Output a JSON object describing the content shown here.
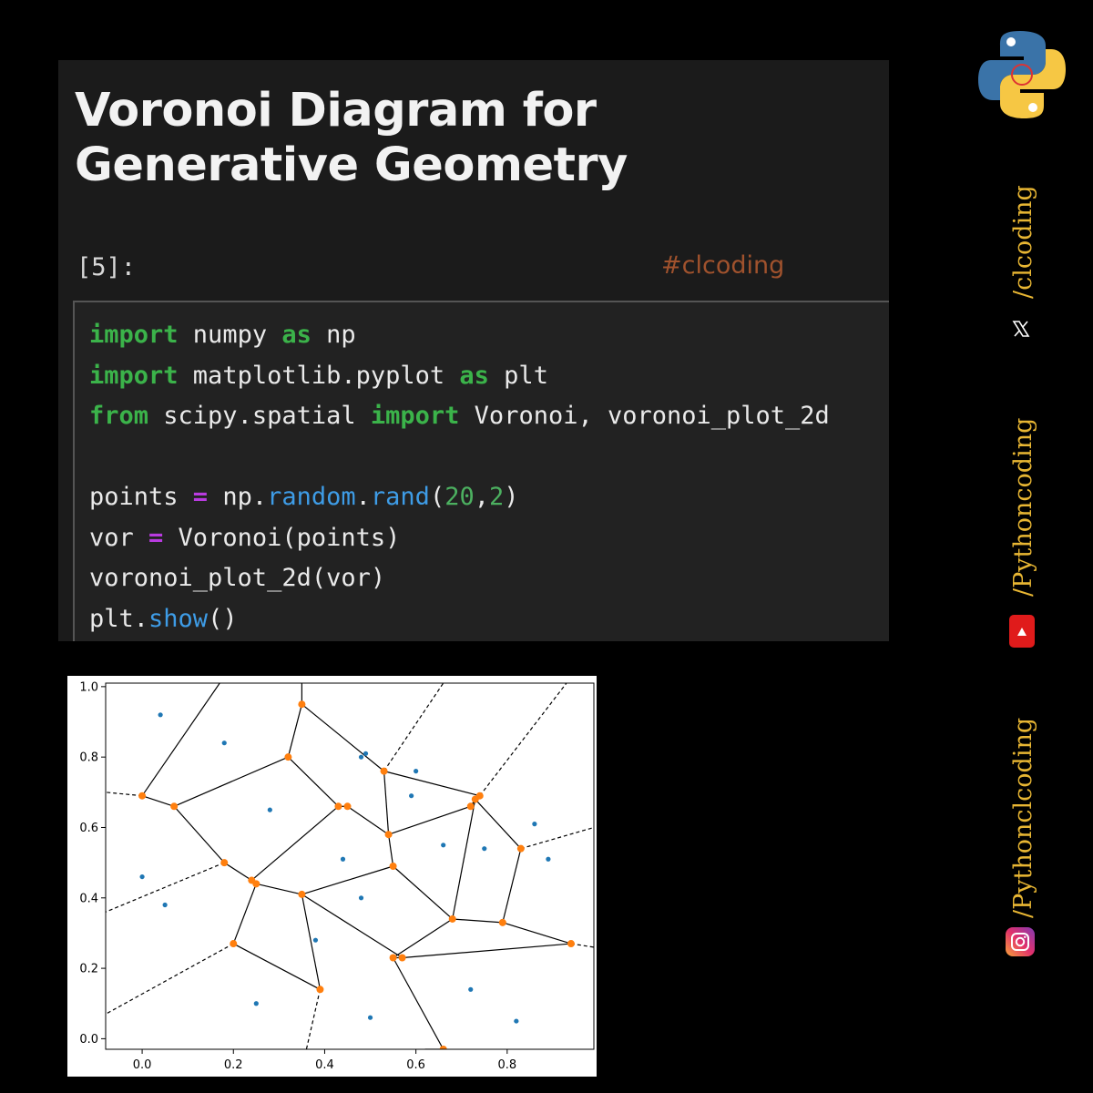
{
  "notebook": {
    "title": "Voronoi Diagram for Generative Geometry",
    "prompt": "[5]:",
    "hashtag": "#clcoding"
  },
  "code": {
    "lines": [
      [
        {
          "t": "import",
          "c": "kw"
        },
        {
          "t": " numpy ",
          "c": ""
        },
        {
          "t": "as",
          "c": "kw"
        },
        {
          "t": " np",
          "c": ""
        }
      ],
      [
        {
          "t": "import",
          "c": "kw"
        },
        {
          "t": " matplotlib.pyplot ",
          "c": ""
        },
        {
          "t": "as",
          "c": "kw"
        },
        {
          "t": " plt",
          "c": ""
        }
      ],
      [
        {
          "t": "from",
          "c": "kw"
        },
        {
          "t": " scipy.spatial ",
          "c": ""
        },
        {
          "t": "import",
          "c": "kw"
        },
        {
          "t": " Voronoi, voronoi_plot_2d",
          "c": ""
        }
      ],
      [],
      [
        {
          "t": "points ",
          "c": ""
        },
        {
          "t": "=",
          "c": "op"
        },
        {
          "t": " np.",
          "c": ""
        },
        {
          "t": "random",
          "c": "fn"
        },
        {
          "t": ".",
          "c": ""
        },
        {
          "t": "rand",
          "c": "fn"
        },
        {
          "t": "(",
          "c": ""
        },
        {
          "t": "20",
          "c": "num"
        },
        {
          "t": ",",
          "c": ""
        },
        {
          "t": "2",
          "c": "num"
        },
        {
          "t": ")",
          "c": ""
        }
      ],
      [
        {
          "t": "vor ",
          "c": ""
        },
        {
          "t": "=",
          "c": "op"
        },
        {
          "t": " Voronoi(points)",
          "c": ""
        }
      ],
      [
        {
          "t": "voronoi_plot_2d(vor)",
          "c": ""
        }
      ],
      [
        {
          "t": "plt.",
          "c": ""
        },
        {
          "t": "show",
          "c": "fn"
        },
        {
          "t": "()",
          "c": ""
        }
      ]
    ]
  },
  "chart_data": {
    "type": "scatter",
    "xlim": [
      -0.08,
      0.99
    ],
    "ylim": [
      -0.03,
      1.01
    ],
    "xticks": [
      "0.0",
      "0.2",
      "0.4",
      "0.6",
      "0.8"
    ],
    "xtick_values": [
      0.0,
      0.2,
      0.4,
      0.6,
      0.8
    ],
    "yticks": [
      "0.0",
      "0.2",
      "0.4",
      "0.6",
      "0.8",
      "1.0"
    ],
    "ytick_values": [
      0.0,
      0.2,
      0.4,
      0.6,
      0.8,
      1.0
    ],
    "grid": false,
    "colors": {
      "points": "#1f77b4",
      "vertices": "#ff7f0e",
      "edges": "#000000"
    },
    "points": [
      [
        0.04,
        0.92
      ],
      [
        0.18,
        0.84
      ],
      [
        0.48,
        0.8
      ],
      [
        0.49,
        0.81
      ],
      [
        0.6,
        0.76
      ],
      [
        0.28,
        0.65
      ],
      [
        0.59,
        0.69
      ],
      [
        0.86,
        0.61
      ],
      [
        0.0,
        0.46
      ],
      [
        0.44,
        0.51
      ],
      [
        0.66,
        0.55
      ],
      [
        0.75,
        0.54
      ],
      [
        0.89,
        0.51
      ],
      [
        0.05,
        0.38
      ],
      [
        0.48,
        0.4
      ],
      [
        0.38,
        0.28
      ],
      [
        0.25,
        0.1
      ],
      [
        0.5,
        0.06
      ],
      [
        0.72,
        0.14
      ],
      [
        0.82,
        0.05
      ]
    ],
    "vertices": [
      [
        0.0,
        0.69
      ],
      [
        0.07,
        0.66
      ],
      [
        0.32,
        0.8
      ],
      [
        0.35,
        0.95
      ],
      [
        0.53,
        0.76
      ],
      [
        0.43,
        0.66
      ],
      [
        0.45,
        0.66
      ],
      [
        0.54,
        0.58
      ],
      [
        0.18,
        0.5
      ],
      [
        0.24,
        0.45
      ],
      [
        0.25,
        0.44
      ],
      [
        0.35,
        0.41
      ],
      [
        0.55,
        0.49
      ],
      [
        0.2,
        0.27
      ],
      [
        0.39,
        0.14
      ],
      [
        0.55,
        0.23
      ],
      [
        0.57,
        0.23
      ],
      [
        0.68,
        0.34
      ],
      [
        0.79,
        0.33
      ],
      [
        0.72,
        0.66
      ],
      [
        0.74,
        0.69
      ],
      [
        0.73,
        0.68
      ],
      [
        0.83,
        0.54
      ],
      [
        0.94,
        0.27
      ],
      [
        0.66,
        -0.03
      ]
    ],
    "edges": [
      [
        0,
        1
      ],
      [
        1,
        8
      ],
      [
        8,
        9
      ],
      [
        9,
        10
      ],
      [
        1,
        2
      ],
      [
        2,
        3
      ],
      [
        2,
        5
      ],
      [
        3,
        4
      ],
      [
        5,
        6
      ],
      [
        6,
        7
      ],
      [
        7,
        4
      ],
      [
        5,
        9
      ],
      [
        7,
        12
      ],
      [
        12,
        11
      ],
      [
        11,
        10
      ],
      [
        10,
        13
      ],
      [
        13,
        14
      ],
      [
        14,
        11
      ],
      [
        12,
        17
      ],
      [
        17,
        15
      ],
      [
        15,
        16
      ],
      [
        16,
        11
      ],
      [
        15,
        24
      ],
      [
        17,
        18
      ],
      [
        18,
        22
      ],
      [
        22,
        21
      ],
      [
        21,
        19
      ],
      [
        19,
        20
      ],
      [
        21,
        17
      ],
      [
        19,
        7
      ],
      [
        4,
        20
      ],
      [
        18,
        23
      ],
      [
        16,
        23
      ]
    ],
    "infinite_edges": [
      [
        0,
        [
          -0.08,
          0.7
        ]
      ],
      [
        8,
        [
          -0.08,
          0.36
        ]
      ],
      [
        13,
        [
          -0.08,
          0.07
        ]
      ],
      [
        14,
        [
          0.36,
          -0.03
        ]
      ],
      [
        4,
        [
          0.66,
          1.01
        ]
      ],
      [
        20,
        [
          0.93,
          1.01
        ]
      ],
      [
        22,
        [
          0.99,
          0.6
        ]
      ],
      [
        23,
        [
          0.99,
          0.26
        ]
      ]
    ],
    "solid_extensions": [
      [
        0,
        [
          0.17,
          1.01
        ]
      ],
      [
        3,
        [
          0.35,
          1.01
        ]
      ],
      [
        24,
        [
          0.62,
          -0.03
        ]
      ]
    ]
  },
  "sidebar": {
    "handle_x": "/clcoding",
    "handle_youtube": "/Pythoncoding",
    "handle_instagram": "/Pythonclcoding",
    "x_icon": "x-logo-icon",
    "youtube_icon": "youtube-icon",
    "instagram_icon": "instagram-icon",
    "logo": "python-logo-icon"
  }
}
